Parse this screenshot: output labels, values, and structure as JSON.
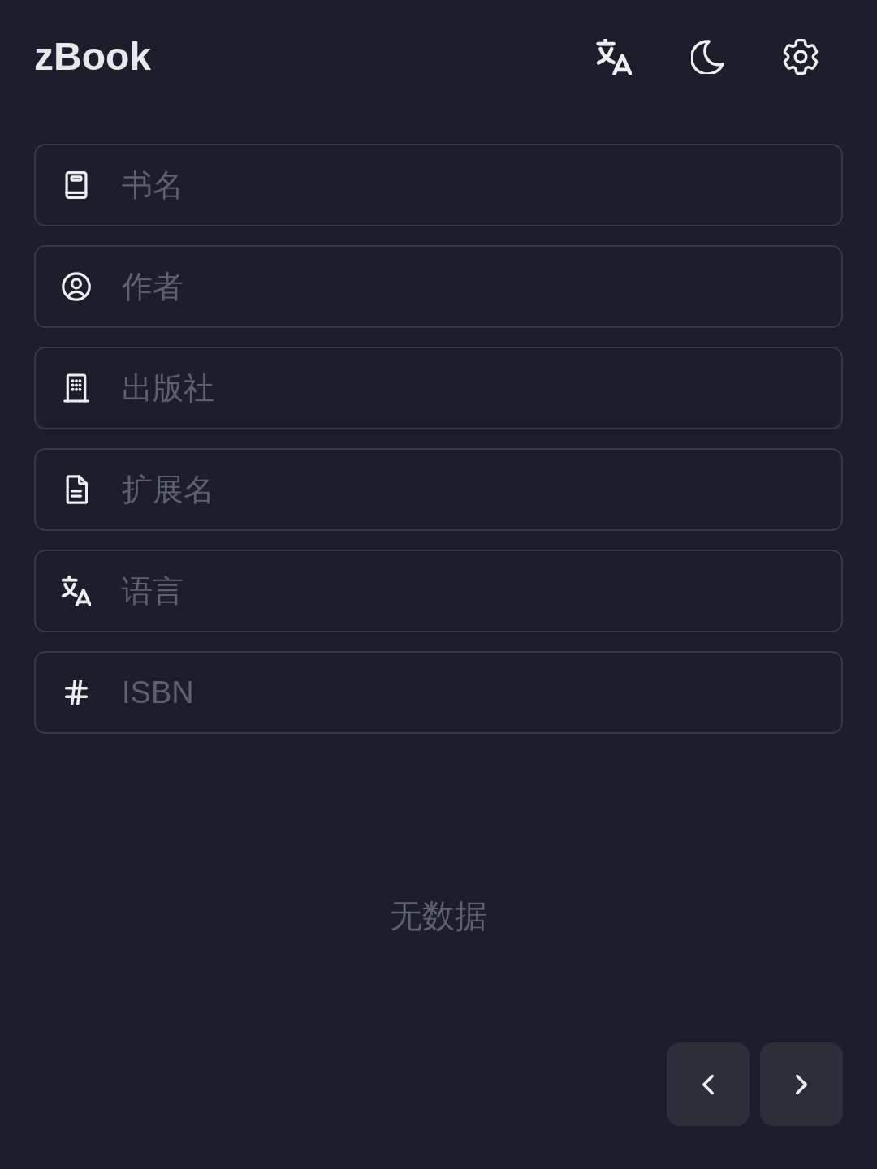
{
  "header": {
    "title": "zBook"
  },
  "fields": [
    {
      "placeholder": "书名"
    },
    {
      "placeholder": "作者"
    },
    {
      "placeholder": "出版社"
    },
    {
      "placeholder": "扩展名"
    },
    {
      "placeholder": "语言"
    },
    {
      "placeholder": "ISBN"
    }
  ],
  "empty_state": "无数据"
}
